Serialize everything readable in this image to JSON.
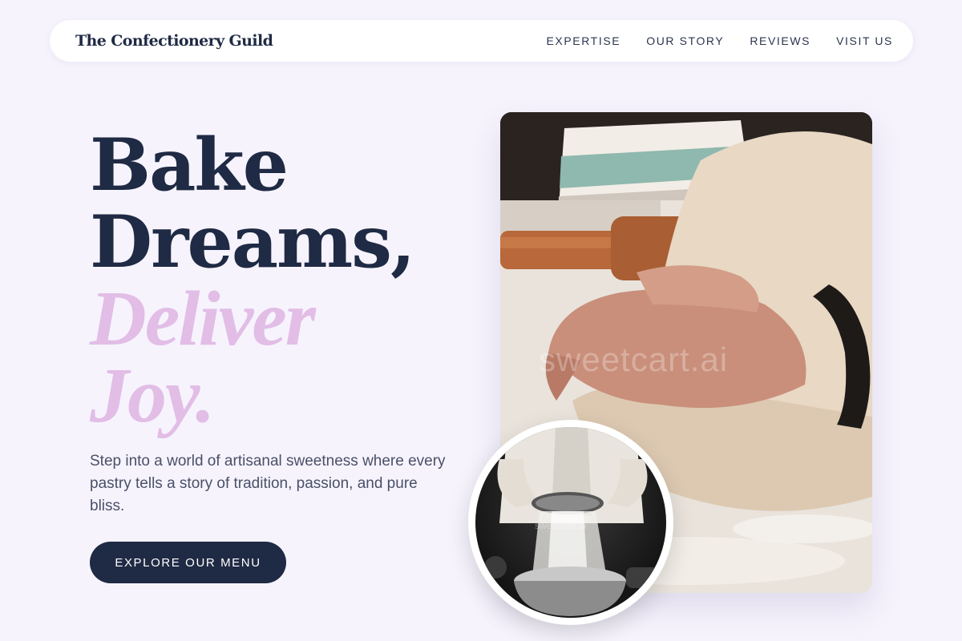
{
  "nav": {
    "brand": "The Confectionery Guild",
    "links": [
      "EXPERTISE",
      "OUR STORY",
      "REVIEWS",
      "VISIT US"
    ]
  },
  "hero": {
    "line1": "Bake",
    "line2": "Dreams,",
    "line3": "Deliver",
    "line4": "Joy.",
    "subtext": "Step into a world of artisanal sweetness where every pastry tells a story of tradition, passion, and pure bliss.",
    "cta": "EXPLORE OUR MENU"
  },
  "images": {
    "main_watermark": "sweetcart.ai",
    "circle_watermark": "sweetcart.ai"
  },
  "colors": {
    "background": "#f6f3fd",
    "primary": "#1f2a44",
    "accent_pink": "#e2bde6"
  }
}
